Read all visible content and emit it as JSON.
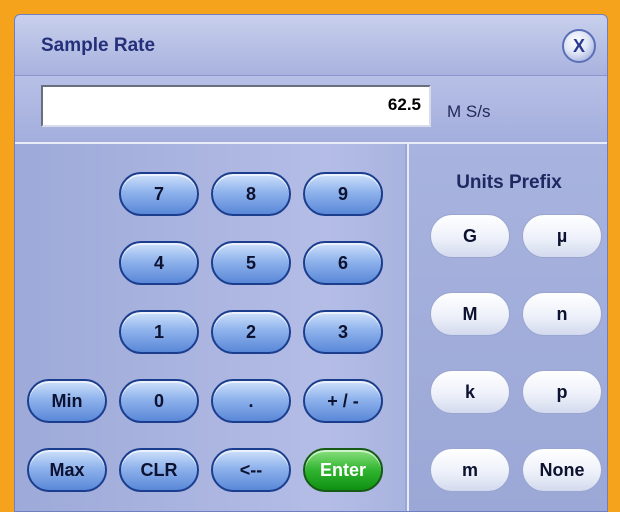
{
  "dialog": {
    "title": "Sample Rate",
    "close_label": "X"
  },
  "entry": {
    "value": "62.5",
    "unit": "M S/s"
  },
  "keypad": {
    "k7": "7",
    "k8": "8",
    "k9": "9",
    "k4": "4",
    "k5": "5",
    "k6": "6",
    "k1": "1",
    "k2": "2",
    "k3": "3",
    "min": "Min",
    "k0": "0",
    "dot": ".",
    "plusminus": "+ / -",
    "max": "Max",
    "clr": "CLR",
    "backspace": "<--",
    "enter": "Enter"
  },
  "prefix": {
    "title": "Units Prefix",
    "G": "G",
    "mu": "µ",
    "M": "M",
    "n": "n",
    "k": "k",
    "p": "p",
    "m": "m",
    "none": "None"
  }
}
